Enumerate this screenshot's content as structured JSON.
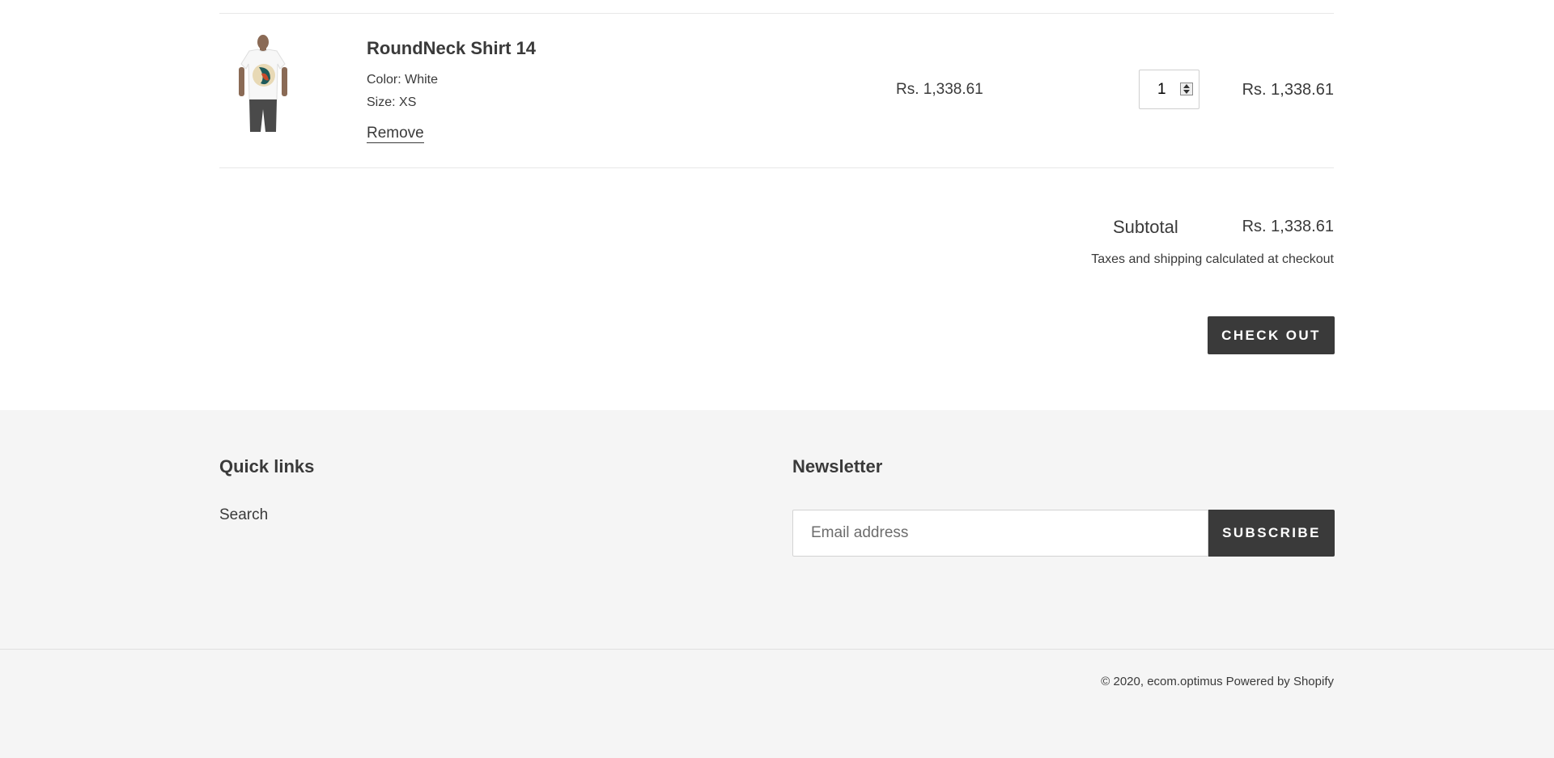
{
  "cart": {
    "item": {
      "title": "RoundNeck Shirt 14",
      "color": "Color: White",
      "size": "Size: XS",
      "remove_label": "Remove",
      "price": "Rs. 1,338.61",
      "quantity": "1",
      "line_total": "Rs. 1,338.61"
    },
    "subtotal_label": "Subtotal",
    "subtotal_value": "Rs. 1,338.61",
    "tax_note": "Taxes and shipping calculated at checkout",
    "checkout_label": "CHECK OUT"
  },
  "footer": {
    "quick_links_title": "Quick links",
    "quick_links": [
      "Search"
    ],
    "newsletter_title": "Newsletter",
    "email_placeholder": "Email address",
    "subscribe_label": "SUBSCRIBE",
    "copyright": "© 2020, ecom.optimus",
    "powered_by": "Powered by Shopify"
  },
  "colors": {
    "text": "#3a3a3a",
    "button_bg": "#3a3a3a",
    "footer_bg": "#f5f5f5"
  }
}
